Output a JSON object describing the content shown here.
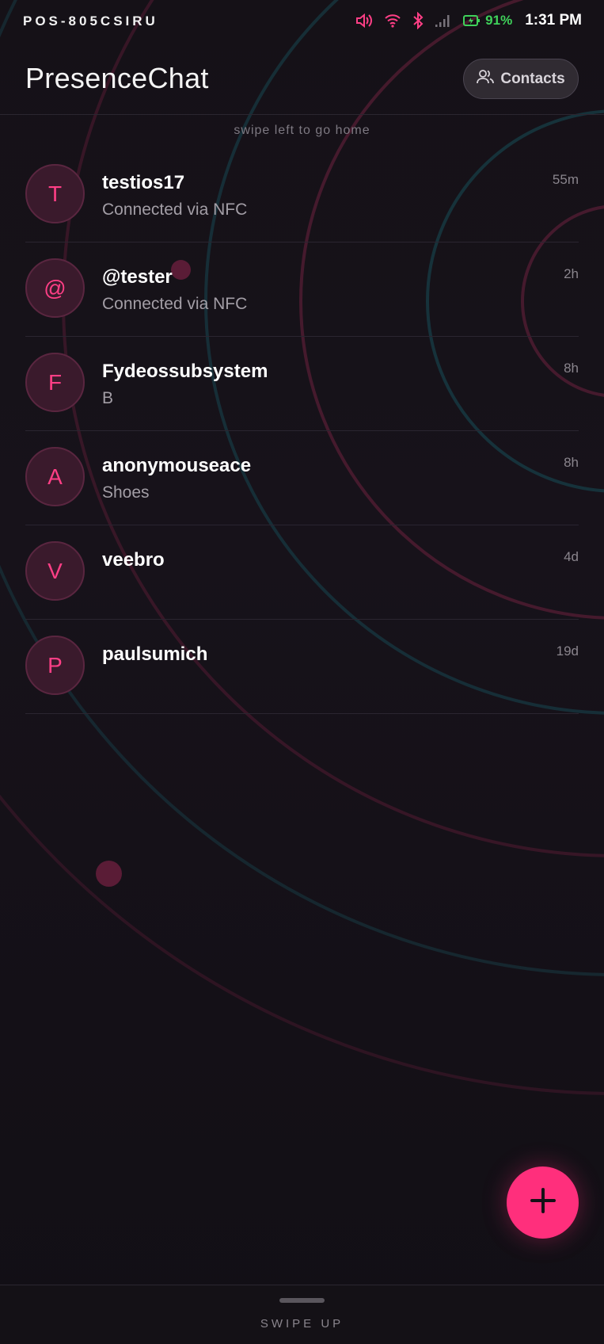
{
  "status_bar": {
    "carrier": "POS-805CSIRU",
    "battery_percent": "91%",
    "time": "1:31 PM",
    "icons": [
      "volume-icon",
      "wifi-icon",
      "bluetooth-icon",
      "signal-icon",
      "battery-charging-icon"
    ]
  },
  "header": {
    "title": "PresenceChat",
    "contacts_label": "Contacts"
  },
  "hint": "swipe left to go home",
  "chats": [
    {
      "initial": "T",
      "name": "testios17",
      "preview": "Connected via NFC",
      "time": "55m"
    },
    {
      "initial": "@",
      "name": "@tester",
      "preview": "Connected via NFC",
      "time": "2h"
    },
    {
      "initial": "F",
      "name": "Fydeossubsystem",
      "preview": "B",
      "time": "8h"
    },
    {
      "initial": "A",
      "name": "anonymouseace",
      "preview": "Shoes",
      "time": "8h"
    },
    {
      "initial": "V",
      "name": "veebro",
      "preview": "",
      "time": "4d"
    },
    {
      "initial": "P",
      "name": "paulsumich",
      "preview": "",
      "time": "19d"
    }
  ],
  "fab": {
    "icon": "plus-icon"
  },
  "bottom": {
    "swipe_label": "SWIPE UP"
  },
  "colors": {
    "accent": "#ff2f7c",
    "battery": "#3fd15a",
    "background": "#151117"
  }
}
